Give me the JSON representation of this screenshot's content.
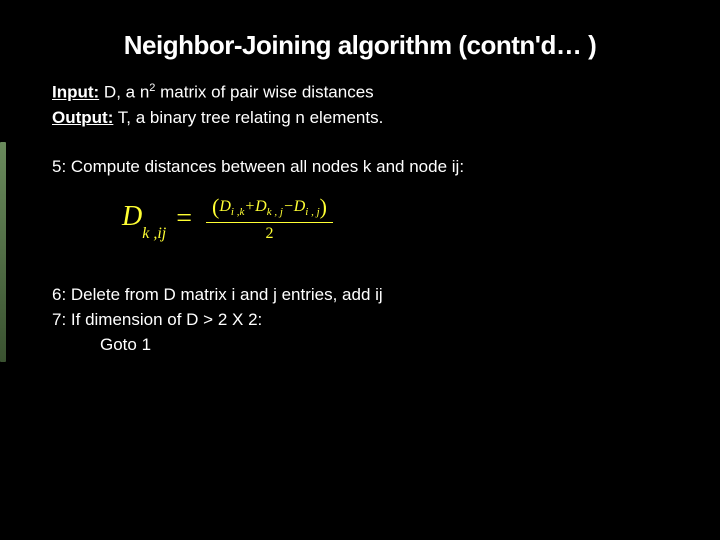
{
  "title": "Neighbor-Joining algorithm (contn'd… )",
  "io": {
    "input_label": "Input:",
    "input_rest": " D, a n",
    "input_sup": "2",
    "input_tail": " matrix of pair wise distances",
    "output_label": "Output:",
    "output_rest": " T, a binary tree relating n elements."
  },
  "steps": {
    "s5": "5: Compute distances between all nodes k and node ij:",
    "s6": "6: Delete from D matrix i and j entries, add ij",
    "s7": "7: If dimension of D > 2 X 2:",
    "s7b": "Goto 1"
  },
  "formula": {
    "D": "D",
    "lhs_sub": "k ,ij",
    "eq": "=",
    "num_D1": "D",
    "num_s1": "i ,k",
    "plus1": "+",
    "num_D2": "D",
    "num_s2": "k , j",
    "minus": "−",
    "num_D3": "D",
    "num_s3": "i , j",
    "den": "2"
  }
}
